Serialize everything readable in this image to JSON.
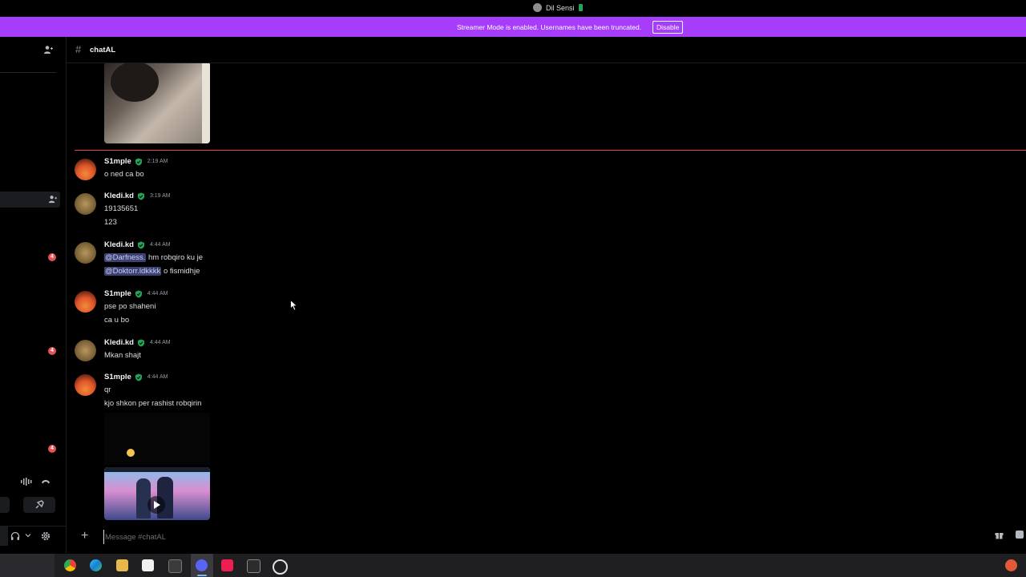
{
  "titlebar": {
    "title": "Dil Sensi"
  },
  "banner": {
    "message": "Streamer Mode is enabled. Usernames have been truncated.",
    "disable_label": "Disable"
  },
  "sidebar": {
    "unread_badges": [
      "4",
      "4",
      "4"
    ]
  },
  "channel": {
    "name": "chatAL",
    "composer_placeholder": "Message #chatAL"
  },
  "messages": [
    {
      "user": "S1mple",
      "time": "2:19 AM",
      "lines": [
        "o ned ca bo"
      ]
    },
    {
      "user": "Kledi.kd",
      "time": "3:19 AM",
      "lines": [
        "19135651",
        "123"
      ]
    },
    {
      "user": "Kledi.kd",
      "time": "4:44 AM",
      "mention1": "@Darfness.",
      "text1": "hm robqiro ku je",
      "mention2": "@Doktorr.ldkkkk",
      "text2": "o fismidhje"
    },
    {
      "user": "S1mple",
      "time": "4:44 AM",
      "lines": [
        "pse po shaheni",
        "ca u bo"
      ]
    },
    {
      "user": "Kledi.kd",
      "time": "4:44 AM",
      "lines": [
        "Mkan shajt"
      ]
    },
    {
      "user": "S1mple",
      "time": "4:44 AM",
      "lines": [
        "qr",
        "kjo shkon per rashist robqirin"
      ]
    }
  ],
  "icons": {
    "friend_add": "add-friend-icon",
    "channel": "hash-icon",
    "verified": "verified-shield-icon",
    "taskbar": [
      "chrome-icon",
      "edge-icon",
      "file-explorer-icon",
      "store-icon",
      "terminal-icon",
      "discord-icon",
      "tiktok-icon",
      "terminal2-icon",
      "screen-recorder-icon"
    ]
  },
  "colors": {
    "banner": "#a53dfa",
    "new_messages_line": "#f23f43",
    "badge": "#e4525a",
    "verified": "#23a559"
  }
}
